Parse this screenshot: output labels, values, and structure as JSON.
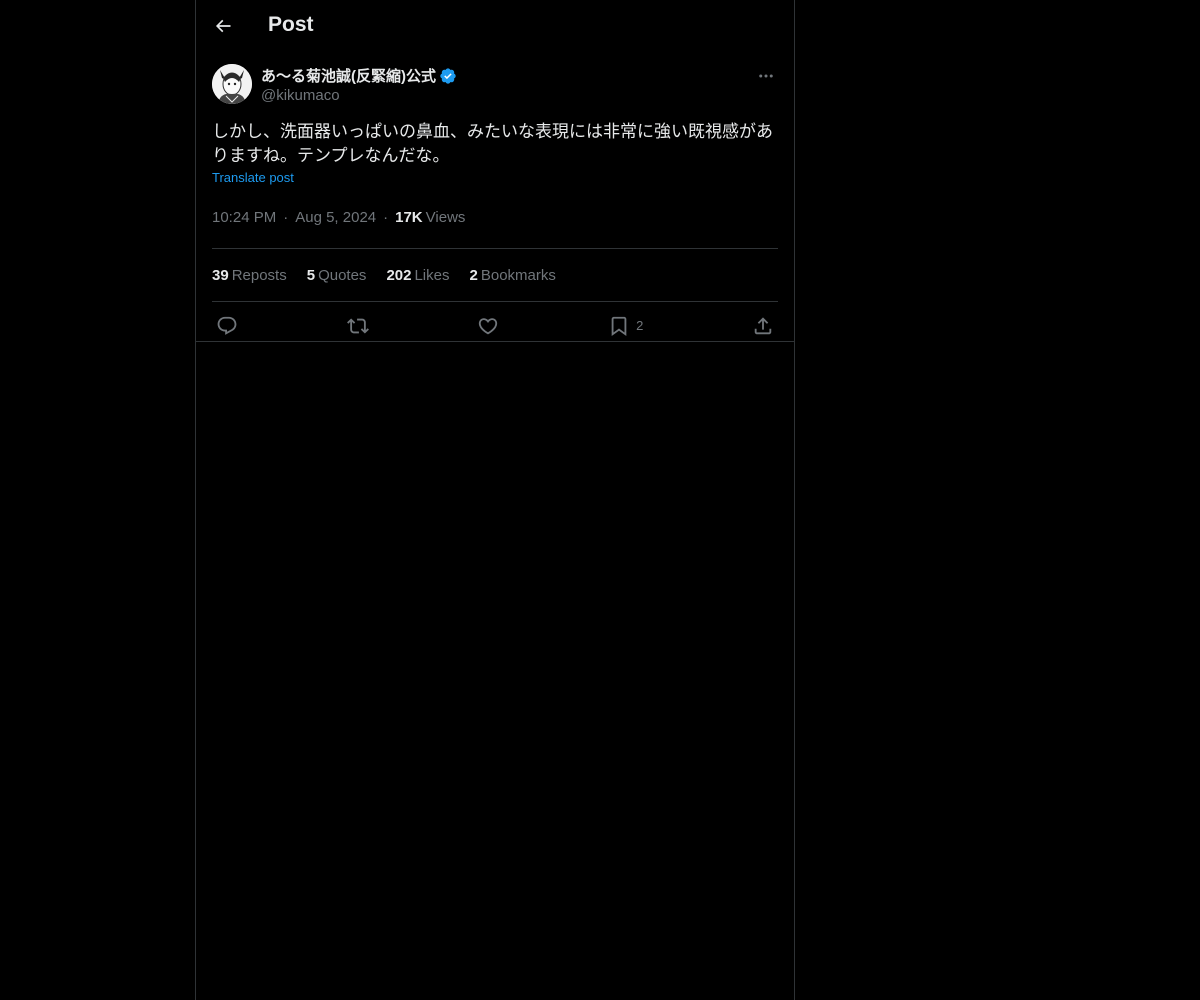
{
  "header": {
    "title": "Post",
    "back_icon": "arrow-left-icon"
  },
  "author": {
    "display_name": "あ〜る菊池誠(反緊縮)公式",
    "handle": "@kikumaco",
    "verified": true,
    "verified_color": "#1d9bf0"
  },
  "post": {
    "text": "しかし、洗面器いっぱいの鼻血、みたいな表現には非常に強い既視感がありますね。テンプレなんだな。",
    "translate_label": "Translate post",
    "time": "10:24 PM",
    "date": "Aug 5, 2024",
    "views_count": "17K",
    "views_label": "Views"
  },
  "stats": [
    {
      "count": "39",
      "label": "Reposts"
    },
    {
      "count": "5",
      "label": "Quotes"
    },
    {
      "count": "202",
      "label": "Likes"
    },
    {
      "count": "2",
      "label": "Bookmarks"
    }
  ],
  "actions": {
    "reply_icon": "reply-icon",
    "repost_icon": "repost-icon",
    "like_icon": "heart-icon",
    "bookmark_icon": "bookmark-icon",
    "bookmark_count": "2",
    "share_icon": "share-icon"
  },
  "colors": {
    "background": "#000000",
    "text": "#e7e9ea",
    "secondary": "#71767b",
    "border": "#2f3336",
    "link": "#1d9bf0"
  }
}
